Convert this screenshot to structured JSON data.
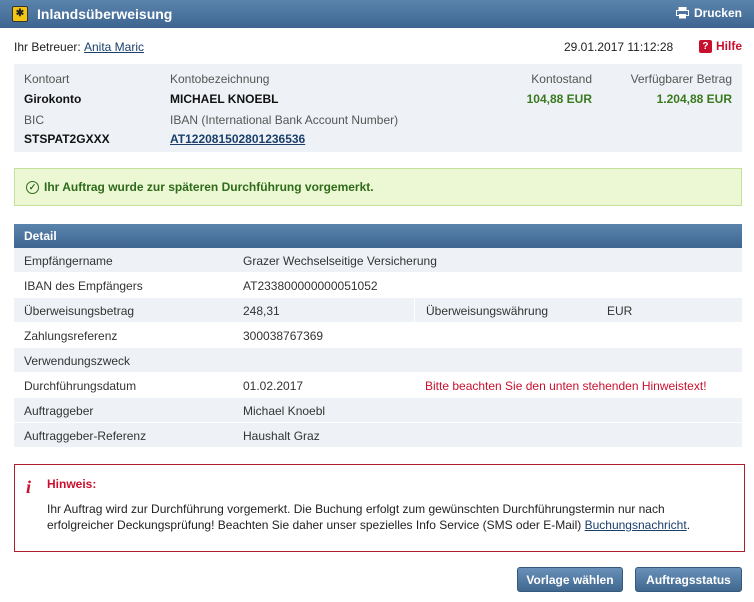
{
  "window": {
    "title": "Inlandsüberweisung",
    "print_label": "Drucken"
  },
  "header": {
    "betreuer_label": "Ihr Betreuer:",
    "betreuer_name": "Anita Maric",
    "datetime": "29.01.2017 11:12:28",
    "help_label": "Hilfe"
  },
  "account": {
    "kontoart_label": "Kontoart",
    "kontoart": "Girokonto",
    "bezeichnung_label": "Kontobezeichnung",
    "bezeichnung": "MICHAEL KNOEBL",
    "kontostand_label": "Kontostand",
    "kontostand": "104,88 EUR",
    "verfuegbar_label": "Verfügbarer Betrag",
    "verfuegbar": "1.204,88 EUR",
    "bic_label": "BIC",
    "bic": "STSPAT2GXXX",
    "iban_label": "IBAN (International Bank Account Number)",
    "iban": "AT122081502801236536"
  },
  "success_message": "Ihr Auftrag wurde zur späteren Durchführung vorgemerkt.",
  "detail": {
    "title": "Detail",
    "rows": [
      {
        "label": "Empfängername",
        "value": "Grazer Wechselseitige Versicherung"
      },
      {
        "label": "IBAN des Empfängers",
        "value": "AT233800000000051052"
      },
      {
        "label": "Überweisungsbetrag",
        "value": "248,31",
        "extra_label": "Überweisungswährung",
        "extra_value": "EUR"
      },
      {
        "label": "Zahlungsreferenz",
        "value": "300038767369"
      },
      {
        "label": "Verwendungszweck",
        "value": ""
      },
      {
        "label": "Durchführungsdatum",
        "value": "01.02.2017",
        "warning": "Bitte beachten Sie den unten stehenden Hinweistext!"
      },
      {
        "label": "Auftraggeber",
        "value": "Michael Knoebl"
      },
      {
        "label": "Auftraggeber-Referenz",
        "value": "Haushalt Graz"
      }
    ]
  },
  "hint": {
    "title": "Hinweis:",
    "line1": "Ihr Auftrag wird zur Durchführung vorgemerkt. Die Buchung erfolgt zum gewünschten Durchführungstermin nur nach",
    "line2": "erfolgreicher Deckungsprüfung! Beachten Sie daher unser spezielles Info Service (SMS oder E-Mail)",
    "link": "Buchungsnachricht",
    "line2_end": "."
  },
  "buttons": {
    "vorlage": "Vorlage wählen",
    "status": "Auftragsstatus"
  },
  "colors": {
    "header_blue": "#4a729b",
    "success_bg": "#ecf7d4",
    "warning_red": "#c8102e",
    "balance_green": "#3a7a1f"
  }
}
